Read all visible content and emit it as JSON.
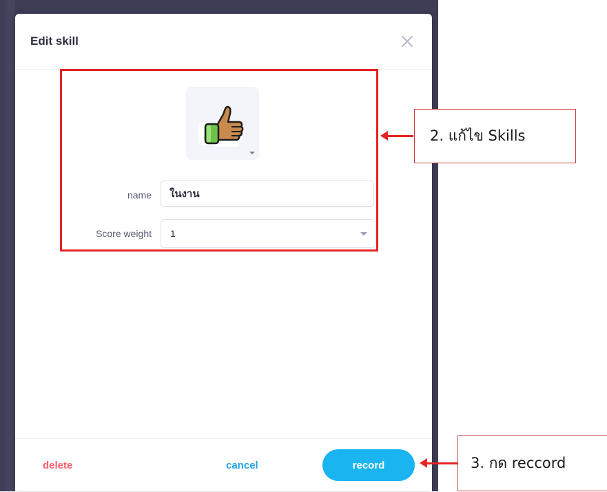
{
  "modal": {
    "title": "Edit skill",
    "icon_name": "thumbs-up-icon",
    "fields": {
      "name_label": "name",
      "name_value": "ในงาน",
      "score_label": "Score weight",
      "score_value": "1"
    },
    "footer": {
      "delete_label": "delete",
      "cancel_label": "cancel",
      "record_label": "record"
    }
  },
  "annotations": {
    "step2": "2. แก้ไข Skills",
    "step3": "3. กด reccord"
  },
  "colors": {
    "annotation_red": "#e52322",
    "record_button": "#1ab4f0",
    "cancel_text": "#1fa3e8",
    "delete_text": "#ff5f6e",
    "backdrop": "#3d3d56"
  }
}
